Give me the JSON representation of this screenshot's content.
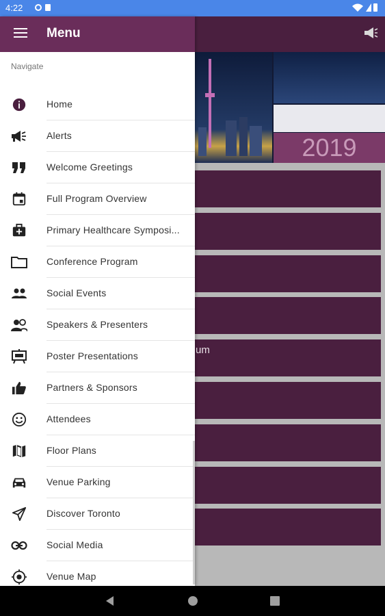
{
  "status": {
    "time": "4:22"
  },
  "drawer": {
    "title": "Menu",
    "section_label": "Navigate"
  },
  "menu": [
    {
      "label": "Home",
      "icon": "info-icon"
    },
    {
      "label": "Alerts",
      "icon": "megaphone-icon"
    },
    {
      "label": "Welcome Greetings",
      "icon": "quote-icon"
    },
    {
      "label": "Full Program Overview",
      "icon": "calendar-icon"
    },
    {
      "label": "Primary Healthcare Symposi...",
      "icon": "medical-kit-icon"
    },
    {
      "label": "Conference Program",
      "icon": "folder-icon"
    },
    {
      "label": "Social Events",
      "icon": "people-icon"
    },
    {
      "label": "Speakers & Presenters",
      "icon": "speakers-icon"
    },
    {
      "label": "Poster Presentations",
      "icon": "easel-icon"
    },
    {
      "label": "Partners & Sponsors",
      "icon": "thumbs-up-icon"
    },
    {
      "label": "Attendees",
      "icon": "smiley-icon"
    },
    {
      "label": "Floor Plans",
      "icon": "map-icon"
    },
    {
      "label": "Venue Parking",
      "icon": "car-icon"
    },
    {
      "label": "Discover Toronto",
      "icon": "send-icon"
    },
    {
      "label": "Social Media",
      "icon": "link-icon"
    },
    {
      "label": "Venue Map",
      "icon": "location-icon"
    }
  ],
  "background": {
    "year": "2019",
    "partial_text": "um"
  },
  "colors": {
    "primary": "#4a1f3f",
    "drawer_header": "#6a2d5a",
    "status_bar": "#4a86e8"
  }
}
